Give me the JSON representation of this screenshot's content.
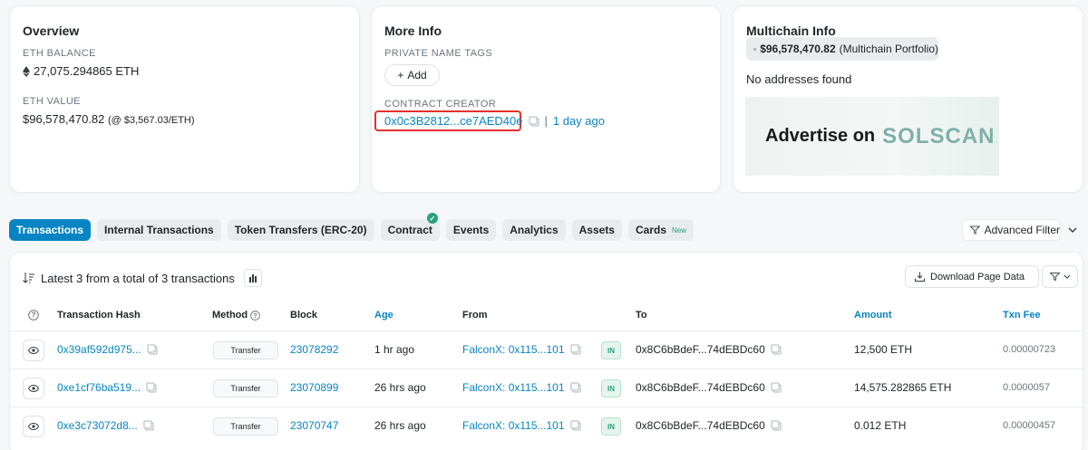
{
  "overview": {
    "title": "Overview",
    "eth_balance_label": "ETH BALANCE",
    "eth_balance": "27,075.294865 ETH",
    "eth_value_label": "ETH VALUE",
    "eth_value": "$96,578,470.82",
    "eth_value_rate": "(@ $3,567.03/ETH)"
  },
  "more_info": {
    "title": "More Info",
    "private_tags_label": "PRIVATE NAME TAGS",
    "add_label": "Add",
    "creator_label": "CONTRACT CREATOR",
    "creator_address": "0x0c3B2812...ce7AED40e",
    "creator_sep": "|",
    "creator_age": "1 day ago"
  },
  "multichain": {
    "title": "Multichain Info",
    "portfolio_value": "$96,578,470.82",
    "portfolio_label": "(Multichain Portfolio)",
    "no_addresses": "No addresses found",
    "ad_text": "Advertise on",
    "ad_brand": "SOLSCAN"
  },
  "tabs": [
    {
      "label": "Transactions",
      "active": true
    },
    {
      "label": "Internal Transactions"
    },
    {
      "label": "Token Transfers (ERC-20)"
    },
    {
      "label": "Contract",
      "verified": true
    },
    {
      "label": "Events"
    },
    {
      "label": "Analytics"
    },
    {
      "label": "Assets"
    },
    {
      "label": "Cards",
      "badge": "New"
    }
  ],
  "advanced_filter_label": "Advanced Filter",
  "transactions": {
    "summary": "Latest 3 from a total of 3 transactions",
    "download_label": "Download Page Data",
    "columns": {
      "hash": "Transaction Hash",
      "method": "Method",
      "block": "Block",
      "age": "Age",
      "from": "From",
      "to": "To",
      "amount": "Amount",
      "fee": "Txn Fee"
    },
    "rows": [
      {
        "hash": "0x39af592d975...",
        "method": "Transfer",
        "block": "23078292",
        "age": "1 hr ago",
        "from": "FalconX: 0x115...101",
        "direction": "IN",
        "to": "0x8C6bBdeF...74dEBDc60",
        "amount": "12,500 ETH",
        "fee": "0.00000723"
      },
      {
        "hash": "0xe1cf76ba519...",
        "method": "Transfer",
        "block": "23070899",
        "age": "26 hrs ago",
        "from": "FalconX: 0x115...101",
        "direction": "IN",
        "to": "0x8C6bBdeF...74dEBDc60",
        "amount": "14,575.282865 ETH",
        "fee": "0.0000057"
      },
      {
        "hash": "0xe3c73072d8...",
        "method": "Transfer",
        "block": "23070747",
        "age": "26 hrs ago",
        "from": "FalconX: 0x115...101",
        "direction": "IN",
        "to": "0x8C6bBdeF...74dEBDc60",
        "amount": "0.012 ETH",
        "fee": "0.00000457"
      }
    ]
  }
}
